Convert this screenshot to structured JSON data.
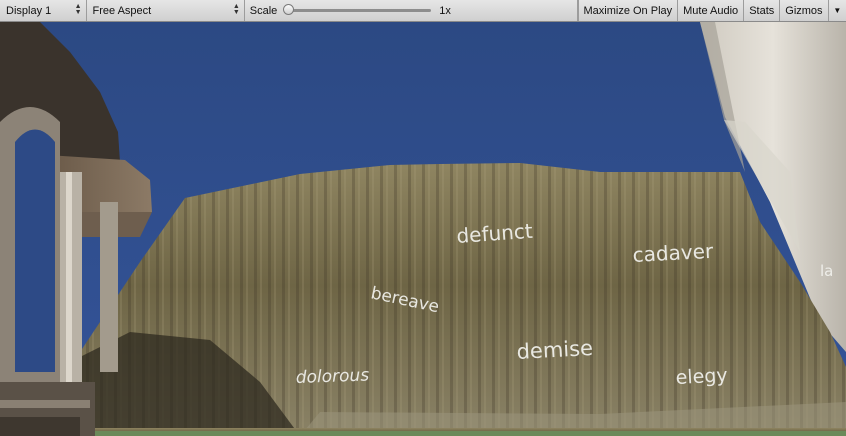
{
  "toolbar": {
    "display_label": "Display 1",
    "aspect_label": "Free Aspect",
    "scale_label": "Scale",
    "scale_value": "1x",
    "maximize_label": "Maximize On Play",
    "mute_label": "Mute Audio",
    "stats_label": "Stats",
    "gizmos_label": "Gizmos"
  },
  "scene": {
    "words": {
      "defunct": "defunct",
      "cadaver": "cadaver",
      "bereave": "bereave",
      "demise": "demise",
      "dolorous": "dolorous",
      "elegy": "elegy",
      "partial": "la"
    },
    "colors": {
      "sky": "#2f4d8a",
      "rock": "#7d7352",
      "ground": "#6b8a5a"
    }
  }
}
